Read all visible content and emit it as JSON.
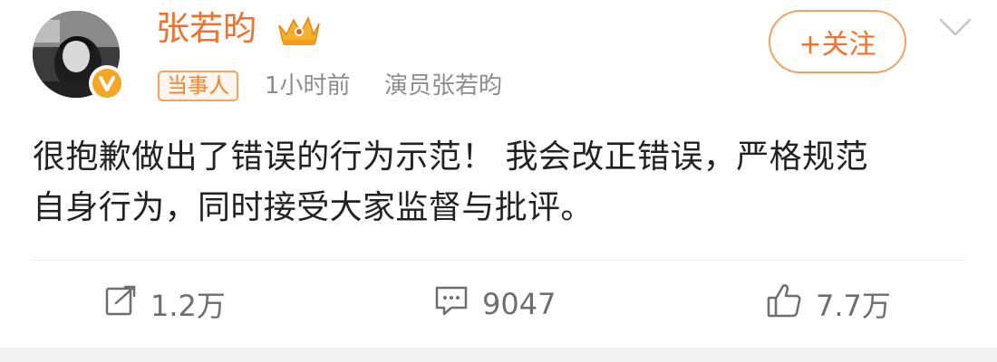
{
  "user": {
    "name": "张若昀",
    "badge": "当事人",
    "time": "1小时前",
    "source": "演员张若昀"
  },
  "follow_button": {
    "label": "+关注"
  },
  "post": {
    "line1": "很抱歉做出了错误的行为示范！ 我会改正错误，严格规范",
    "line2": "自身行为，同时接受大家监督与批评。"
  },
  "actions": {
    "repost_count": "1.2万",
    "comment_count": "9047",
    "like_count": "7.7万"
  },
  "colors": {
    "accent": "#f3702a",
    "muted": "#8c8c8c",
    "text": "#222222"
  },
  "icons": [
    "verified-v-icon",
    "crown-icon",
    "chevron-down-icon",
    "repost-icon",
    "comment-icon",
    "like-icon"
  ]
}
